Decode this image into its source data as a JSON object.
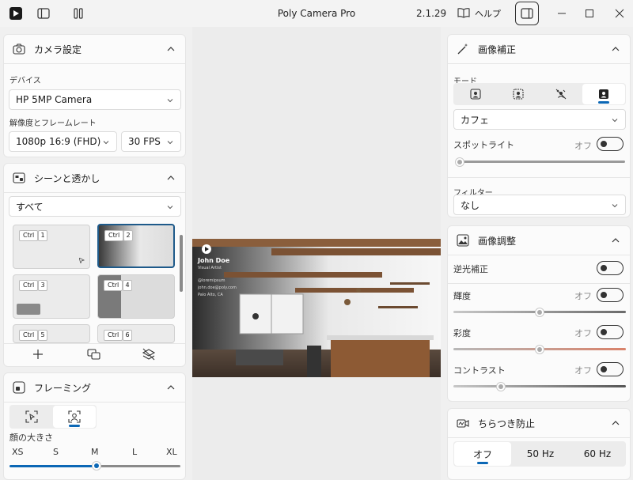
{
  "window": {
    "title": "Poly Camera Pro",
    "version": "2.1.29",
    "help_label": "ヘルプ"
  },
  "camera_settings": {
    "title": "カメラ設定",
    "device_label": "デバイス",
    "device_value": "HP 5MP Camera",
    "resolution_label": "解像度とフレームレート",
    "resolution_value": "1080p 16:9 (FHD)",
    "fps_value": "30 FPS"
  },
  "scenes": {
    "title": "シーンと透かし",
    "filter_value": "すべて",
    "tiles": [
      {
        "ctrl": "Ctrl",
        "num": "1"
      },
      {
        "ctrl": "Ctrl",
        "num": "2"
      },
      {
        "ctrl": "Ctrl",
        "num": "3"
      },
      {
        "ctrl": "Ctrl",
        "num": "4"
      },
      {
        "ctrl": "Ctrl",
        "num": "5"
      },
      {
        "ctrl": "Ctrl",
        "num": "6"
      }
    ]
  },
  "framing": {
    "title": "フレーミング",
    "face_size_label": "顔の大きさ",
    "sizes": [
      "XS",
      "S",
      "M",
      "L",
      "XL"
    ],
    "selected_size": "M"
  },
  "preview": {
    "name": "John Doe",
    "subtitle": "Visual Artist",
    "contact_lines": [
      "@loremipsum",
      "john.doe@poly.com",
      "Palo Alto, CA"
    ]
  },
  "image_correction": {
    "title": "画像補正",
    "mode_label": "モード",
    "preset_value": "カフェ",
    "spotlight_label": "スポットライト",
    "spotlight_state": "オフ",
    "spotlight_level": 0.0,
    "filter_label": "フィルター",
    "filter_value": "なし"
  },
  "image_adjust": {
    "title": "画像調整",
    "backlight_label": "逆光補正",
    "brightness_label": "輝度",
    "brightness_state": "オフ",
    "brightness_level": 0.5,
    "saturation_label": "彩度",
    "saturation_state": "オフ",
    "saturation_level": 0.5,
    "contrast_label": "コントラスト",
    "contrast_state": "オフ",
    "contrast_level": 0.3
  },
  "flicker": {
    "title": "ちらつき防止",
    "options": [
      "オフ",
      "50 Hz",
      "60 Hz"
    ],
    "selected": "オフ"
  },
  "colors": {
    "accent": "#0b67b5",
    "saturation_gradient_end": "#d9826a"
  }
}
